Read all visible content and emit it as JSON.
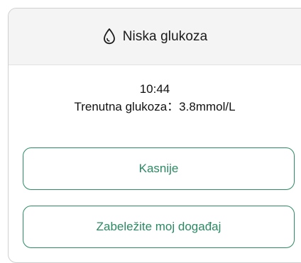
{
  "dialog": {
    "title": "Niska glukoza",
    "icon": "drop-icon"
  },
  "alert": {
    "time": "10:44",
    "glucose_line": "Trenutna glukoza：3.8mmol/L"
  },
  "buttons": {
    "later_label": "Kasnije",
    "log_event_label": "Zabeležite moj događaj"
  },
  "colors": {
    "accent": "#2b8a63",
    "header_bg": "#f4f4f4",
    "border": "#cfcfcf"
  }
}
